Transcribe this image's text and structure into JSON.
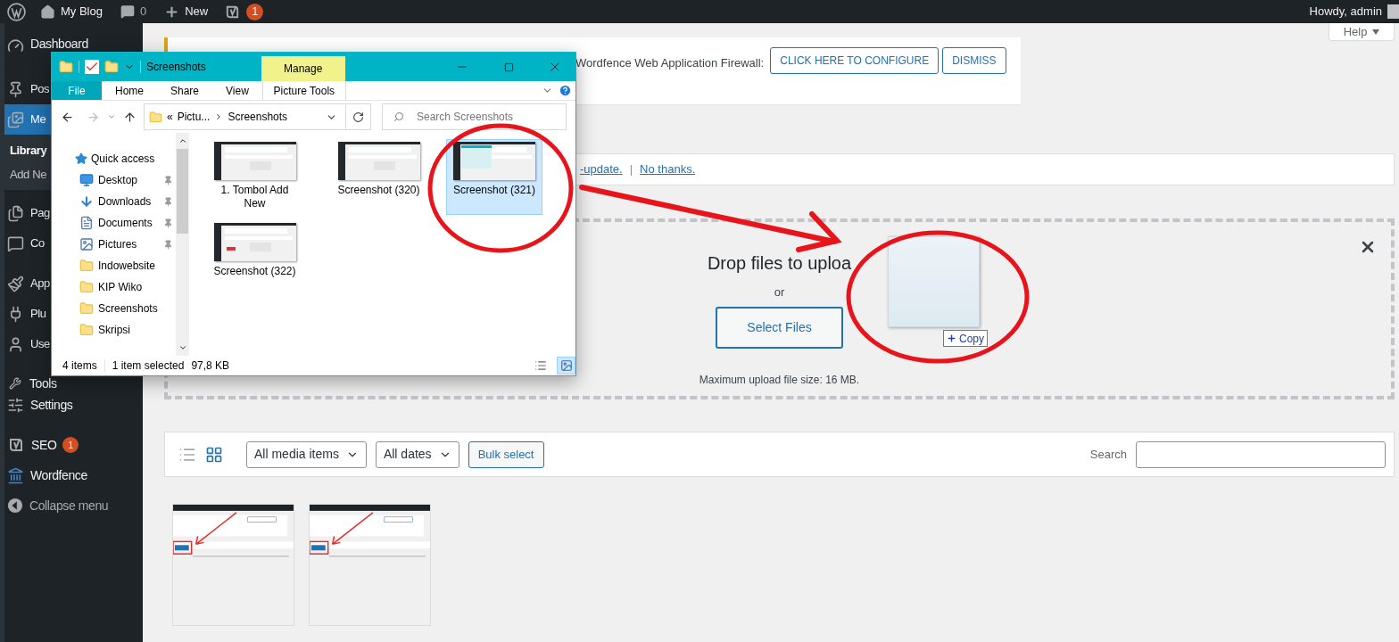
{
  "admin_bar": {
    "site": "My Blog",
    "comments": "0",
    "new": "New",
    "seo_badge": "1",
    "greeting": "Howdy, admin"
  },
  "sidebar": {
    "items": [
      {
        "label": "Dashboard",
        "selected": false
      },
      {
        "label": "Pos",
        "selected": false
      },
      {
        "label": "Me",
        "selected": true,
        "submenu": [
          {
            "label": "Library",
            "selected": true
          },
          {
            "label": "Add Ne",
            "selected": false
          }
        ]
      },
      {
        "label": "Pag",
        "selected": false
      },
      {
        "label": "Co",
        "selected": false
      },
      {
        "label": "App",
        "selected": false
      },
      {
        "label": "Plu",
        "selected": false
      },
      {
        "label": "Use",
        "selected": false
      },
      {
        "label": "Tools",
        "selected": false
      },
      {
        "label": "Settings",
        "selected": false
      },
      {
        "label": "SEO",
        "selected": false,
        "badge": "1"
      },
      {
        "label": "Wordfence",
        "selected": false
      },
      {
        "label": "Collapse menu",
        "selected": false
      }
    ]
  },
  "help_tab": {
    "label": "Help"
  },
  "firewall_notice": {
    "text": "Wordfence Web Application Firewall:",
    "buttons": [
      "CLICK HERE TO CONFIGURE",
      "DISMISS"
    ]
  },
  "update_notice": {
    "link": "-update.",
    "separator": "|",
    "dismiss_link": "No thanks."
  },
  "uploader": {
    "title": "Drop files to uploa",
    "or": "or",
    "button": "Select Files",
    "max_size": "Maximum upload file size: 16 MB."
  },
  "drag_ghost": {
    "label": "Copy"
  },
  "media_toolbar": {
    "views": [
      {
        "selected": false
      },
      {
        "selected": true
      }
    ],
    "filters": [
      "All media items",
      "All dates"
    ],
    "bulk_button": "Bulk select",
    "search_label": "Search"
  },
  "explorer": {
    "title": "Screenshots",
    "context_label": "Manage",
    "ribbon_tabs": [
      {
        "label": "File",
        "selected": true,
        "kind": "plain"
      },
      {
        "label": "Home",
        "selected": false,
        "kind": "plain"
      },
      {
        "label": "Share",
        "selected": false,
        "kind": "plain"
      },
      {
        "label": "View",
        "selected": false,
        "kind": "plain"
      },
      {
        "label": "Picture Tools",
        "selected": false,
        "kind": "contextual"
      }
    ],
    "address": {
      "overflow": "«",
      "parent": "Pictu...",
      "current": "Screenshots"
    },
    "search_placeholder": "Search Screenshots",
    "nav": [
      {
        "label": "Quick access",
        "pinned": false
      },
      {
        "label": "Desktop",
        "pinned": true
      },
      {
        "label": "Downloads",
        "pinned": true
      },
      {
        "label": "Documents",
        "pinned": true
      },
      {
        "label": "Pictures",
        "pinned": true
      },
      {
        "label": "Indowebsite",
        "pinned": false
      },
      {
        "label": "KIP Wiko",
        "pinned": false
      },
      {
        "label": "Screenshots",
        "pinned": false
      },
      {
        "label": "Skripsi",
        "pinned": false
      }
    ],
    "files": [
      {
        "name": "1. Tombol Add New",
        "selected": false
      },
      {
        "name": "Screenshot (320)",
        "selected": false
      },
      {
        "name": "Screenshot (321)",
        "selected": true
      },
      {
        "name": "Screenshot (322)",
        "selected": false
      }
    ],
    "status": {
      "count": "4 items",
      "selection": "1 item selected",
      "size": "97,8 KB"
    },
    "view_buttons": [
      {
        "selected": false
      },
      {
        "selected": true
      }
    ]
  }
}
